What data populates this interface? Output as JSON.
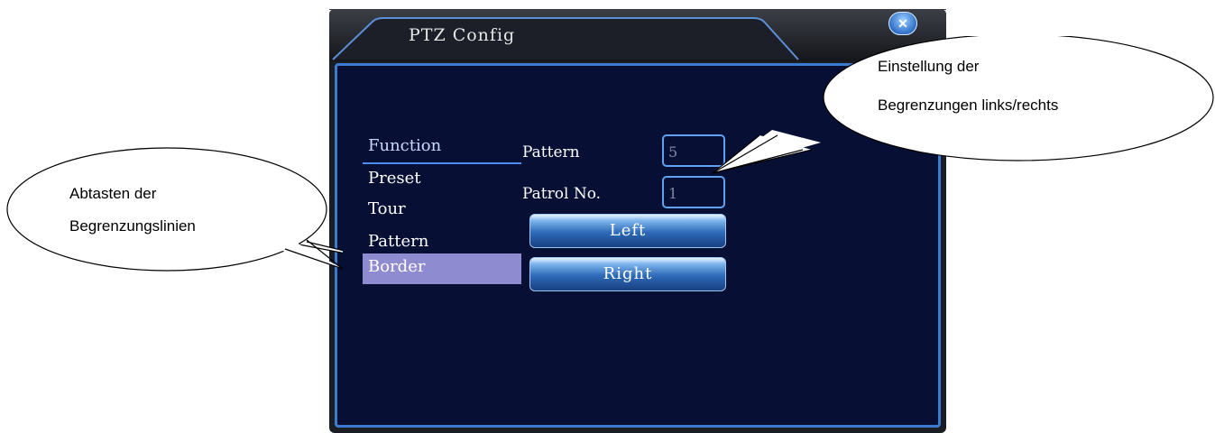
{
  "window": {
    "title": "PTZ Config",
    "close_label": "✕"
  },
  "menu": {
    "header": "Function",
    "items": [
      "Preset",
      "Tour",
      "Pattern",
      "Border"
    ],
    "selected": "Border"
  },
  "fields": {
    "pattern_label": "Pattern",
    "pattern_value": "5",
    "patrol_label": "Patrol No.",
    "patrol_value": "1"
  },
  "buttons": {
    "left": "Left",
    "right": "Right"
  },
  "annotations": {
    "left_line1": "Abtasten der",
    "left_line2": "Begrenzungslinien",
    "right_line1": "Einstellung der",
    "right_line2": "Begrenzungen links/rechts"
  },
  "colors": {
    "panel_bg": "#071034",
    "panel_border": "#3d7bd0",
    "selected_bg": "#8f8bd0",
    "button_accent": "#2d6ab8"
  }
}
